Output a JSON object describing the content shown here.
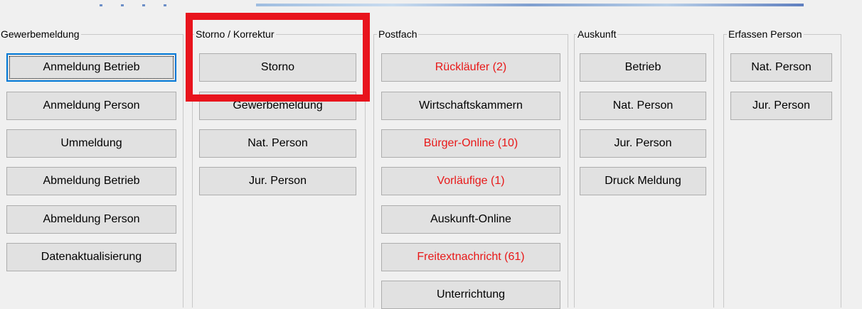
{
  "groups": {
    "gewerbemeldung": {
      "title": "Gewerbemeldung",
      "buttons": [
        "Anmeldung Betrieb",
        "Anmeldung Person",
        "Ummeldung",
        "Abmeldung Betrieb",
        "Abmeldung Person",
        "Datenaktualisierung"
      ]
    },
    "storno": {
      "title": "Storno / Korrektur",
      "buttons": [
        "Storno",
        "Gewerbemeldung",
        "Nat. Person",
        "Jur. Person"
      ]
    },
    "postfach": {
      "title": "Postfach",
      "buttons": [
        "Rückläufer (2)",
        "Wirtschaftskammern",
        "Bürger-Online (10)",
        "Vorläufige (1)",
        "Auskunft-Online",
        "Freitextnachricht (61)",
        "Unterrichtung"
      ]
    },
    "auskunft": {
      "title": "Auskunft",
      "buttons": [
        "Betrieb",
        "Nat. Person",
        "Jur. Person",
        "Druck Meldung"
      ]
    },
    "erfassen": {
      "title": "Erfassen Person",
      "buttons": [
        "Nat. Person",
        "Jur. Person"
      ]
    }
  },
  "colors": {
    "alert_text": "#e81818",
    "highlight_box": "#e8141d",
    "focus": "#0078d7"
  }
}
